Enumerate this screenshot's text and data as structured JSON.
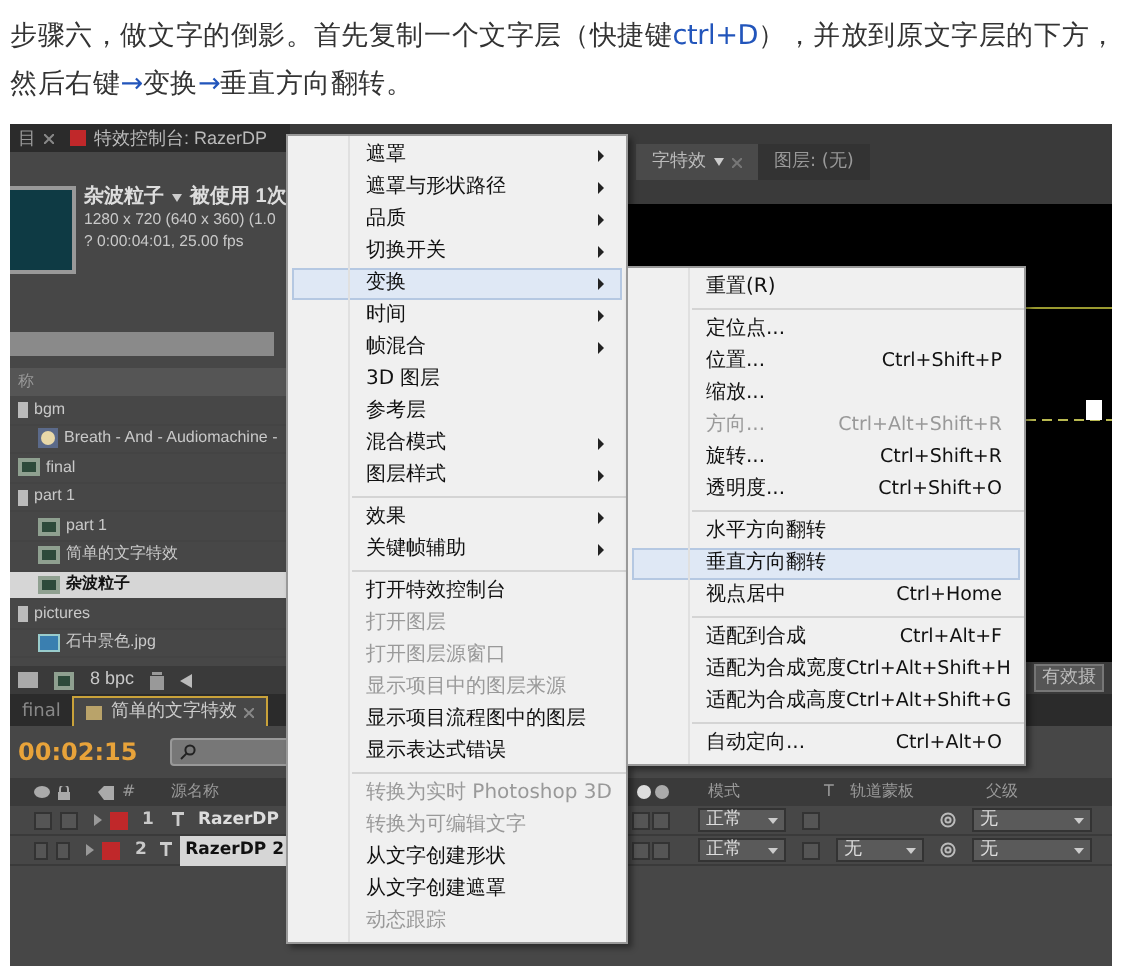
{
  "article": {
    "segments": [
      {
        "text": "步骤六，做文字的倒影。首先复制一个文字层（快捷键",
        "kind": "plain"
      },
      {
        "text": "ctrl+D",
        "kind": "accent"
      },
      {
        "text": "），并放到原文字层的下方，然后右键",
        "kind": "plain"
      },
      {
        "text": "→",
        "kind": "accent"
      },
      {
        "text": "变换",
        "kind": "plain"
      },
      {
        "text": "→",
        "kind": "accent"
      },
      {
        "text": "垂直方向翻转。",
        "kind": "plain"
      }
    ]
  },
  "ae_window": {
    "panel_tabs": [
      {
        "label": "目",
        "selected": false
      },
      {
        "label": "特效控制台: RazerDP",
        "selected": true
      }
    ],
    "project_panel": {
      "footage_name": "杂波粒子",
      "usage": "被使用 1次",
      "dimensions": "1280 x 720  (640 x 360) (1.0",
      "duration": "? 0:00:04:01, 25.00 fps",
      "column_header": "称",
      "bit_depth": "8 bpc",
      "items": [
        {
          "label": "bgm",
          "kind": "folder",
          "selected": false,
          "children": [
            {
              "label": "Breath - And - Audiomachine -",
              "kind": "audio",
              "selected": false
            }
          ]
        },
        {
          "label": "final",
          "kind": "comp",
          "selected": false
        },
        {
          "label": "part 1",
          "kind": "folder",
          "selected": false,
          "children": [
            {
              "label": "part 1",
              "kind": "comp",
              "selected": false
            },
            {
              "label": "简单的文字特效",
              "kind": "comp",
              "selected": false
            },
            {
              "label": "杂波粒子",
              "kind": "comp",
              "selected": true
            }
          ]
        },
        {
          "label": "pictures",
          "kind": "folder",
          "selected": false,
          "children": [
            {
              "label": "石中景色.jpg",
              "kind": "image",
              "selected": false
            }
          ]
        }
      ]
    },
    "viewer": {
      "tabs": [
        {
          "label": "字特效",
          "selected": true
        },
        {
          "label": "图层: (无)",
          "selected": false
        }
      ],
      "camera": "有效摄"
    },
    "timeline": {
      "tabs": [
        {
          "label": "final",
          "selected": false
        },
        {
          "label": "简单的文字特效",
          "selected": true
        }
      ],
      "timecode": "00:02:15",
      "columns": {
        "number": "#",
        "source": "源名称",
        "mode": "模式",
        "t": "T",
        "track_matte": "轨道蒙板",
        "parent": "父级"
      },
      "layers": [
        {
          "number": "1",
          "name": "RazerDP",
          "mode": "正常",
          "parent": "无",
          "selected": false
        },
        {
          "number": "2",
          "name": "RazerDP 2",
          "mode": "正常",
          "track_matte": "无",
          "parent": "无",
          "selected": true
        }
      ]
    },
    "context_menu": {
      "items": [
        {
          "kind": "item",
          "label": "遮罩",
          "submenu": true,
          "disabled": false,
          "selected": false
        },
        {
          "kind": "item",
          "label": "遮罩与形状路径",
          "submenu": true,
          "disabled": false,
          "selected": false
        },
        {
          "kind": "item",
          "label": "品质",
          "submenu": true,
          "disabled": false,
          "selected": false
        },
        {
          "kind": "item",
          "label": "切换开关",
          "submenu": true,
          "disabled": false,
          "selected": false
        },
        {
          "kind": "item",
          "label": "变换",
          "submenu": true,
          "disabled": false,
          "selected": true
        },
        {
          "kind": "item",
          "label": "时间",
          "submenu": true,
          "disabled": false,
          "selected": false
        },
        {
          "kind": "item",
          "label": "帧混合",
          "submenu": true,
          "disabled": false,
          "selected": false
        },
        {
          "kind": "item",
          "label": "3D 图层",
          "submenu": false,
          "disabled": false,
          "selected": false
        },
        {
          "kind": "item",
          "label": "参考层",
          "submenu": false,
          "disabled": false,
          "selected": false
        },
        {
          "kind": "item",
          "label": "混合模式",
          "submenu": true,
          "disabled": false,
          "selected": false
        },
        {
          "kind": "item",
          "label": "图层样式",
          "submenu": true,
          "disabled": false,
          "selected": false
        },
        {
          "kind": "separator"
        },
        {
          "kind": "item",
          "label": "效果",
          "submenu": true,
          "disabled": false,
          "selected": false
        },
        {
          "kind": "item",
          "label": "关键帧辅助",
          "submenu": true,
          "disabled": false,
          "selected": false
        },
        {
          "kind": "separator"
        },
        {
          "kind": "item",
          "label": "打开特效控制台",
          "submenu": false,
          "disabled": false,
          "selected": false
        },
        {
          "kind": "item",
          "label": "打开图层",
          "submenu": false,
          "disabled": true,
          "selected": false
        },
        {
          "kind": "item",
          "label": "打开图层源窗口",
          "submenu": false,
          "disabled": true,
          "selected": false
        },
        {
          "kind": "item",
          "label": "显示项目中的图层来源",
          "submenu": false,
          "disabled": true,
          "selected": false
        },
        {
          "kind": "item",
          "label": "显示项目流程图中的图层",
          "submenu": false,
          "disabled": false,
          "selected": false
        },
        {
          "kind": "item",
          "label": "显示表达式错误",
          "submenu": false,
          "disabled": false,
          "selected": false
        },
        {
          "kind": "separator"
        },
        {
          "kind": "item",
          "label": "转换为实时 Photoshop 3D",
          "submenu": false,
          "disabled": true,
          "selected": false
        },
        {
          "kind": "item",
          "label": "转换为可编辑文字",
          "submenu": false,
          "disabled": true,
          "selected": false
        },
        {
          "kind": "item",
          "label": "从文字创建形状",
          "submenu": false,
          "disabled": false,
          "selected": false
        },
        {
          "kind": "item",
          "label": "从文字创建遮罩",
          "submenu": false,
          "disabled": false,
          "selected": false
        },
        {
          "kind": "item",
          "label": "动态跟踪",
          "submenu": false,
          "disabled": true,
          "selected": false
        }
      ]
    },
    "submenu": {
      "items": [
        {
          "kind": "item",
          "label": "重置(R)",
          "disabled": false,
          "selected": false
        },
        {
          "kind": "separator"
        },
        {
          "kind": "item",
          "label": "定位点...",
          "disabled": false,
          "selected": false
        },
        {
          "kind": "item",
          "label": "位置...",
          "shortcut": "Ctrl+Shift+P",
          "disabled": false,
          "selected": false
        },
        {
          "kind": "item",
          "label": "缩放...",
          "disabled": false,
          "selected": false
        },
        {
          "kind": "item",
          "label": "方向...",
          "shortcut": "Ctrl+Alt+Shift+R",
          "disabled": true,
          "selected": false
        },
        {
          "kind": "item",
          "label": "旋转...",
          "shortcut": "Ctrl+Shift+R",
          "disabled": false,
          "selected": false
        },
        {
          "kind": "item",
          "label": "透明度...",
          "shortcut": "Ctrl+Shift+O",
          "disabled": false,
          "selected": false
        },
        {
          "kind": "separator"
        },
        {
          "kind": "item",
          "label": "水平方向翻转",
          "disabled": false,
          "selected": false
        },
        {
          "kind": "item",
          "label": "垂直方向翻转",
          "disabled": false,
          "selected": true
        },
        {
          "kind": "item",
          "label": "视点居中",
          "shortcut": "Ctrl+Home",
          "disabled": false,
          "selected": false
        },
        {
          "kind": "separator"
        },
        {
          "kind": "item",
          "label": "适配到合成",
          "shortcut": "Ctrl+Alt+F",
          "disabled": false,
          "selected": false
        },
        {
          "kind": "item",
          "label": "适配为合成宽度",
          "shortcut": "Ctrl+Alt+Shift+H",
          "disabled": false,
          "selected": false
        },
        {
          "kind": "item",
          "label": "适配为合成高度",
          "shortcut": "Ctrl+Alt+Shift+G",
          "disabled": false,
          "selected": false
        },
        {
          "kind": "separator"
        },
        {
          "kind": "item",
          "label": "自动定向...",
          "shortcut": "Ctrl+Alt+O",
          "disabled": false,
          "selected": false
        }
      ]
    }
  }
}
